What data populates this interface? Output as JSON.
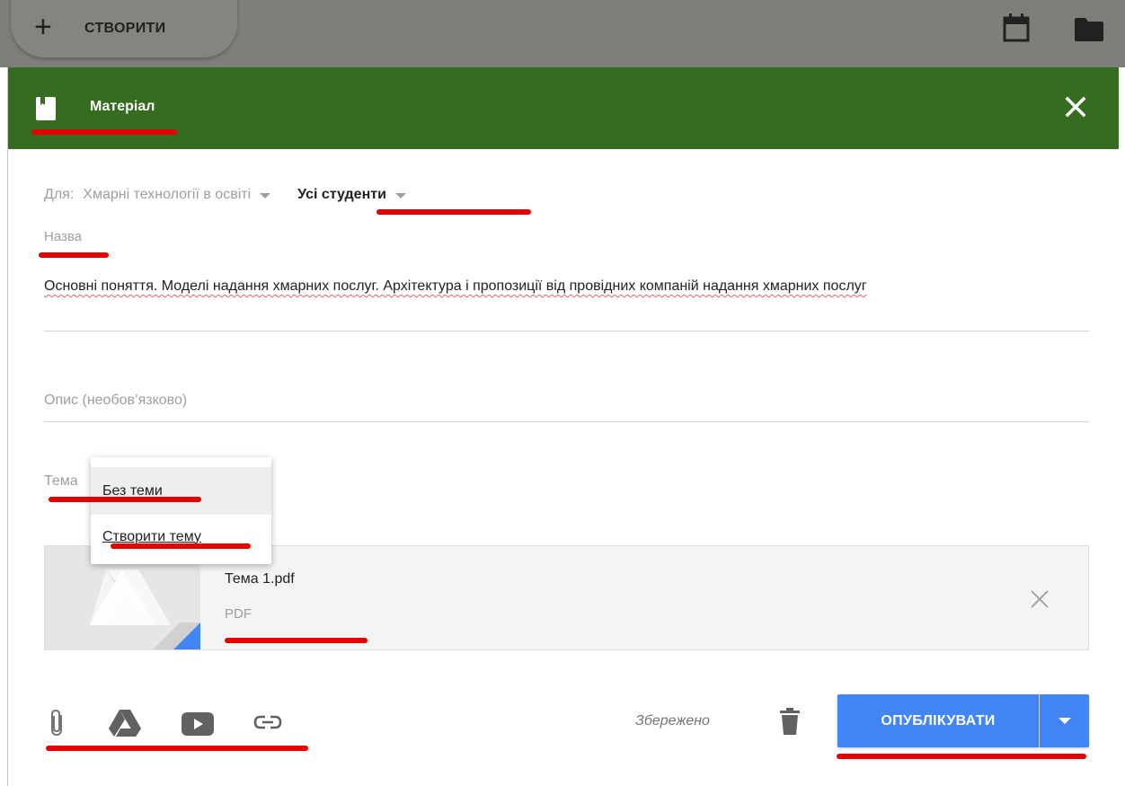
{
  "top_bar": {
    "create_label": "СТВОРИТИ",
    "create_icon": "plus-icon",
    "calendar_icon": "calendar-icon",
    "folder_icon": "folder-icon",
    "background": "#7f7f79"
  },
  "dialog": {
    "header": {
      "title": "Матеріал",
      "type_icon": "material-icon",
      "close_icon": "close-icon",
      "color": "#366c1f"
    },
    "for_label": "Для:",
    "course": "Хмарні технології в освіті",
    "audience": "Усі студенти",
    "title_field": {
      "label": "Назва",
      "value": "Основні поняття. Моделі надання хмарних послуг. Архітектура і пропозиції від провідних компаній надання хмарних послуг"
    },
    "description_field": {
      "placeholder": "Опис (необов’язково)"
    },
    "topic_field": {
      "label": "Тема",
      "menu_items": [
        "Без теми",
        "Створити тему"
      ],
      "selected": "Без теми"
    },
    "attachment": {
      "file_name": "Тема 1.pdf",
      "file_type": "PDF",
      "thumbnail_icon": "google-drive-icon",
      "remove_icon": "close-icon"
    },
    "footer": {
      "tools": [
        "attach-file-icon",
        "google-drive-icon",
        "youtube-icon",
        "link-icon"
      ],
      "status": "Збережено",
      "delete_icon": "trash-icon",
      "publish_label": "ОПУБЛІКУВАТИ",
      "publish_menu_icon": "caret-down-icon",
      "accent": "#4285f4"
    }
  }
}
